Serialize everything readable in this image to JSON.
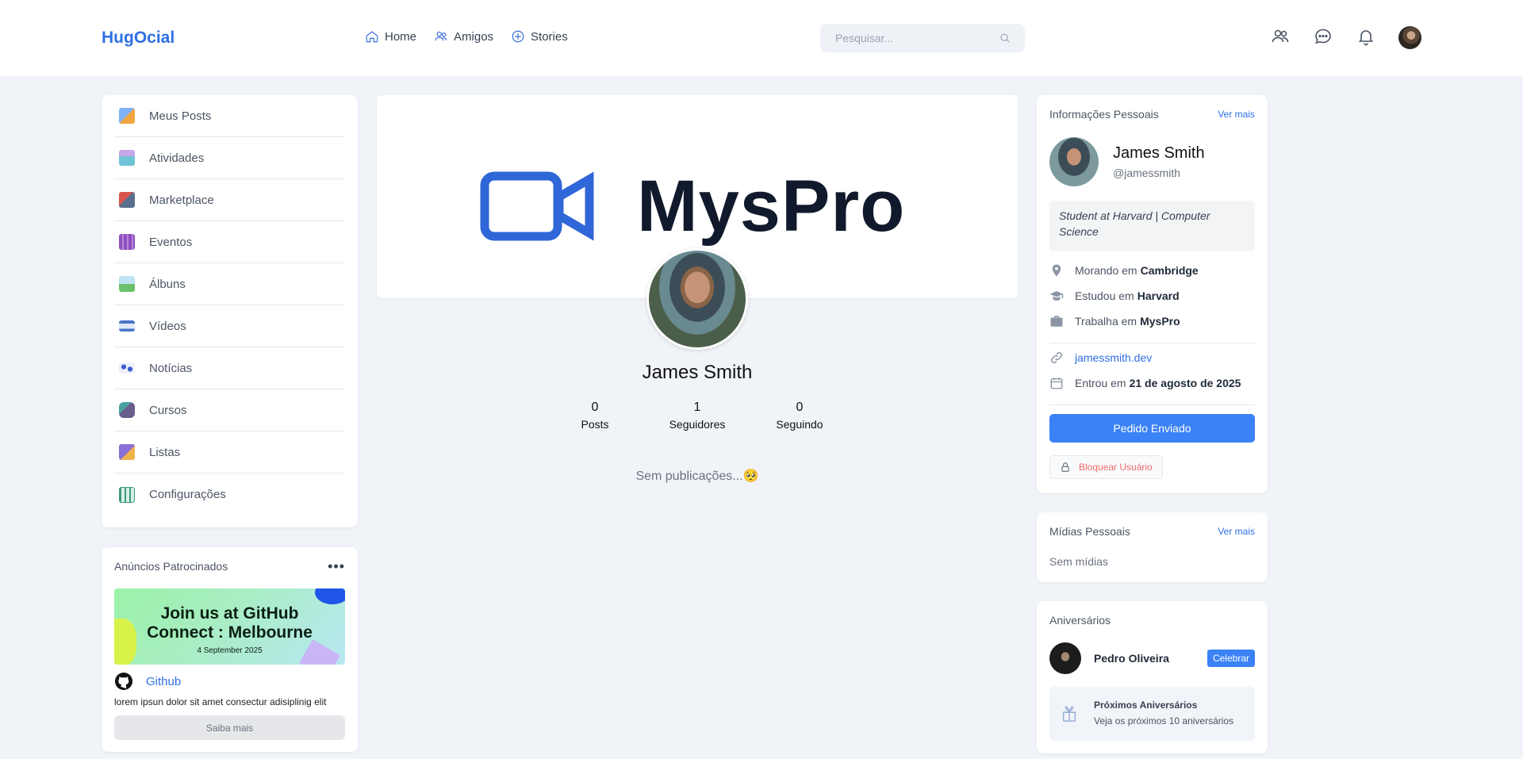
{
  "header": {
    "logo": "HugOcial",
    "nav": [
      {
        "label": "Home",
        "icon": "home-icon"
      },
      {
        "label": "Amigos",
        "icon": "friends-icon"
      },
      {
        "label": "Stories",
        "icon": "stories-icon"
      }
    ],
    "search_placeholder": "Pesquisar...",
    "icons": [
      "friends-icon",
      "chat-icon",
      "bell-icon",
      "avatar"
    ]
  },
  "sidebar": {
    "items": [
      {
        "label": "Meus Posts"
      },
      {
        "label": "Atividades"
      },
      {
        "label": "Marketplace"
      },
      {
        "label": "Eventos"
      },
      {
        "label": "Álbuns"
      },
      {
        "label": "Vídeos"
      },
      {
        "label": "Notícias"
      },
      {
        "label": "Cursos"
      },
      {
        "label": "Listas"
      },
      {
        "label": "Configurações"
      }
    ]
  },
  "ads": {
    "title": "Anúncios Patrocinados",
    "banner_line1": "Join us at GitHub",
    "banner_line2": "Connect : Melbourne",
    "banner_date": "4 September 2025",
    "brand": "Github",
    "text": "lorem ipsun dolor sit amet consectur adisiplinig elit",
    "button": "Saiba mais"
  },
  "profile": {
    "cover_text": "MysPro",
    "name": "James Smith",
    "stats": [
      {
        "value": "0",
        "label": "Posts"
      },
      {
        "value": "1",
        "label": "Seguidores"
      },
      {
        "value": "0",
        "label": "Seguindo"
      }
    ],
    "empty_posts": "Sem publicações...🥺"
  },
  "info": {
    "title": "Informações Pessoais",
    "see_more": "Ver mais",
    "name": "James Smith",
    "handle": "@jamessmith",
    "bio": "Student at Harvard | Computer Science",
    "lives_label": "Morando em",
    "lives_value": "Cambridge",
    "studied_label": "Estudou em",
    "studied_value": "Harvard",
    "works_label": "Trabalha em",
    "works_value": "MysPro",
    "website": "jamessmith.dev",
    "joined_label": "Entrou em",
    "joined_value": "21 de agosto de 2025",
    "primary_button": "Pedido Enviado",
    "block_button": "Bloquear Usuário"
  },
  "media": {
    "title": "Mídias Pessoais",
    "see_more": "Ver mais",
    "empty": "Sem mídias"
  },
  "birthdays": {
    "title": "Aniversários",
    "person": "Pedro Oliveira",
    "celebrate": "Celebrar",
    "upcoming_title": "Próximos Aniversários",
    "upcoming_sub": "Veja os próximos 10 aniversários"
  },
  "colors": {
    "accent": "#3b82f6",
    "link": "#2f6fe4",
    "danger": "#ef6b6b",
    "background": "#f0f3f8"
  }
}
